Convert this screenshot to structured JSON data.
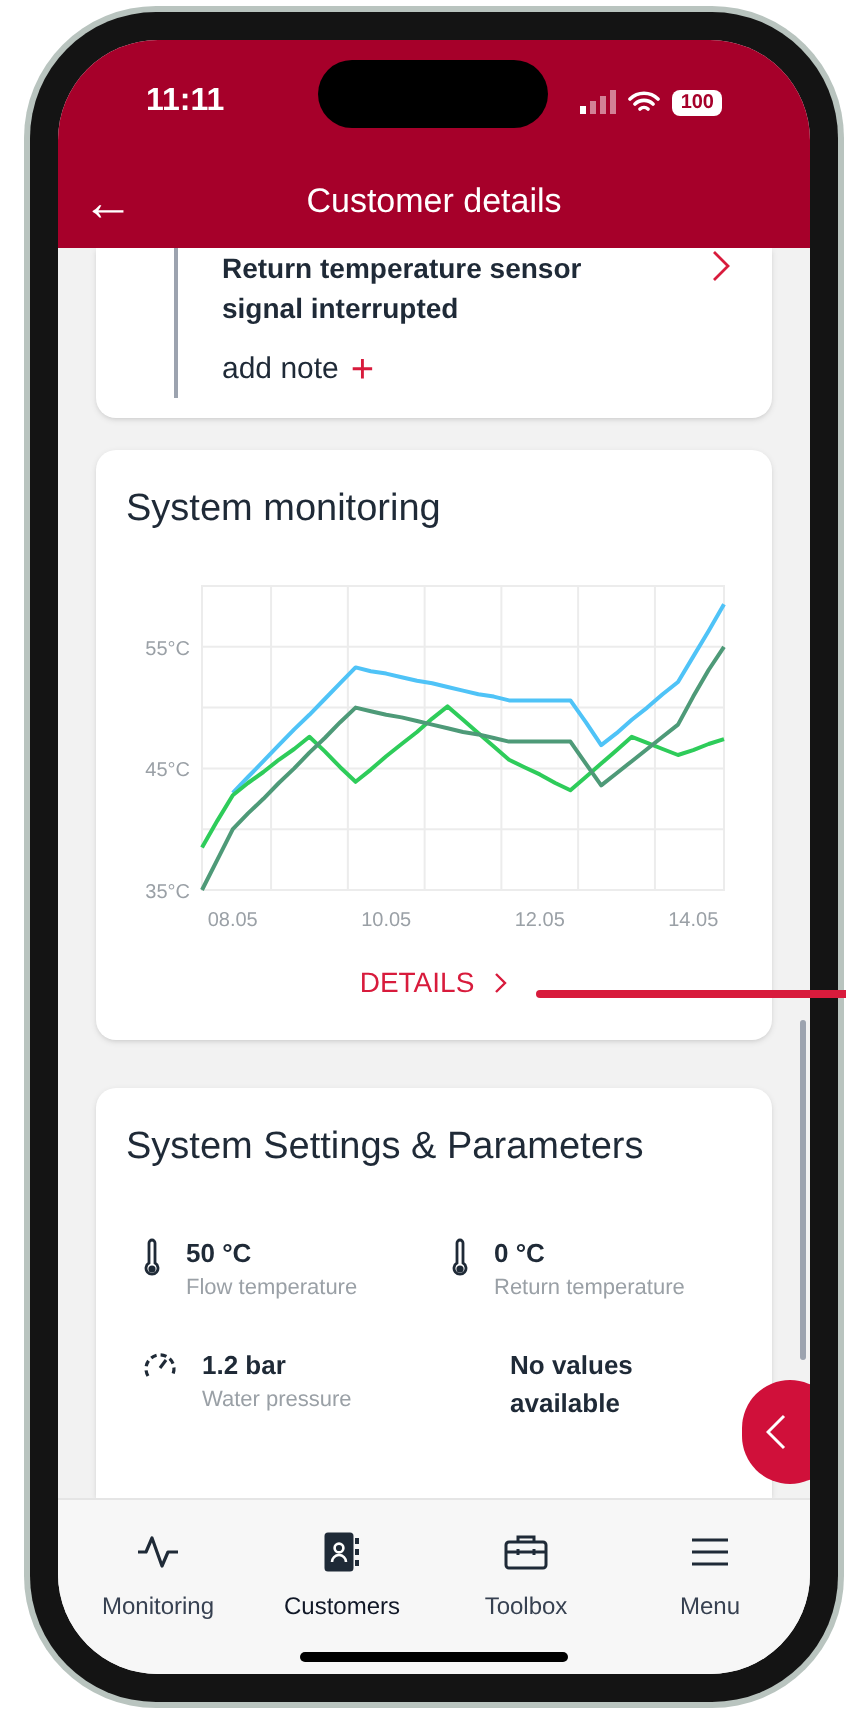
{
  "status_bar": {
    "time": "11:11",
    "battery": "100"
  },
  "header": {
    "back": "←",
    "title": "Customer details"
  },
  "alert_card": {
    "message": "Return temperature sensor signal interrupted",
    "add_note": "add note",
    "add_symbol": "+"
  },
  "monitoring_card": {
    "title": "System monitoring",
    "details_link": "DETAILS",
    "chart_data": {
      "type": "line",
      "categories": [
        null,
        null,
        "08.05",
        null,
        null,
        null,
        null,
        null,
        null,
        null,
        null,
        null,
        "10.05",
        null,
        null,
        null,
        null,
        null,
        null,
        null,
        null,
        null,
        "12.05",
        null,
        null,
        null,
        null,
        null,
        null,
        null,
        null,
        null,
        "14.05",
        null,
        null
      ],
      "ylim": [
        35,
        60
      ],
      "yticks": [
        {
          "value": 35,
          "label": "35°C"
        },
        {
          "value": 45,
          "label": "45°C"
        },
        {
          "value": 55,
          "label": "55°C"
        }
      ],
      "series": [
        {
          "color": "#4fc3f7",
          "values": [
            null,
            null,
            43.0,
            44.3,
            45.6,
            46.9,
            48.2,
            49.4,
            50.7,
            52.0,
            53.3,
            53.0,
            52.8,
            52.5,
            52.2,
            52.0,
            51.7,
            51.4,
            51.1,
            50.9,
            50.6,
            50.6,
            50.6,
            50.6,
            50.6,
            48.8,
            46.9,
            47.9,
            49.0,
            50.0,
            51.1,
            52.1,
            54.2,
            56.3,
            58.5
          ]
        },
        {
          "color": "#2ecc5a",
          "values": [
            38.5,
            40.7,
            42.8,
            43.8,
            44.7,
            45.7,
            46.6,
            47.6,
            46.4,
            45.1,
            43.9,
            44.9,
            46.0,
            47.0,
            48.0,
            49.1,
            50.1,
            49.0,
            47.9,
            46.8,
            45.7,
            45.1,
            44.5,
            43.8,
            43.2,
            44.3,
            45.4,
            46.5,
            47.6,
            47.1,
            46.6,
            46.1,
            46.5,
            47.0,
            47.4
          ]
        },
        {
          "color": "#4e9a78",
          "values": [
            35.0,
            37.5,
            40.0,
            41.3,
            42.5,
            43.8,
            45.0,
            46.3,
            47.5,
            48.8,
            50.0,
            49.7,
            49.4,
            49.2,
            48.9,
            48.6,
            48.3,
            48.0,
            47.8,
            47.5,
            47.2,
            47.2,
            47.2,
            47.2,
            47.2,
            45.4,
            43.6,
            44.6,
            45.6,
            46.6,
            47.6,
            48.6,
            50.9,
            53.1,
            55.0
          ]
        }
      ]
    }
  },
  "settings_card": {
    "title": "System Settings & Parameters",
    "parameters": [
      {
        "kind": "temperature",
        "value": "50 °C",
        "label": "Flow temperature"
      },
      {
        "kind": "temperature",
        "value": "0 °C",
        "label": "Return temperature"
      },
      {
        "kind": "pressure",
        "value": "1.2 bar",
        "label": "Water pressure"
      },
      {
        "kind": "none",
        "value": "No values available"
      }
    ]
  },
  "bottom_nav": [
    {
      "kind": "pulse",
      "label": "Monitoring",
      "selected": false
    },
    {
      "kind": "contacts",
      "label": "Customers",
      "selected": true
    },
    {
      "kind": "toolbox",
      "label": "Toolbox",
      "selected": false
    },
    {
      "kind": "menu",
      "label": "Menu",
      "selected": false
    }
  ]
}
